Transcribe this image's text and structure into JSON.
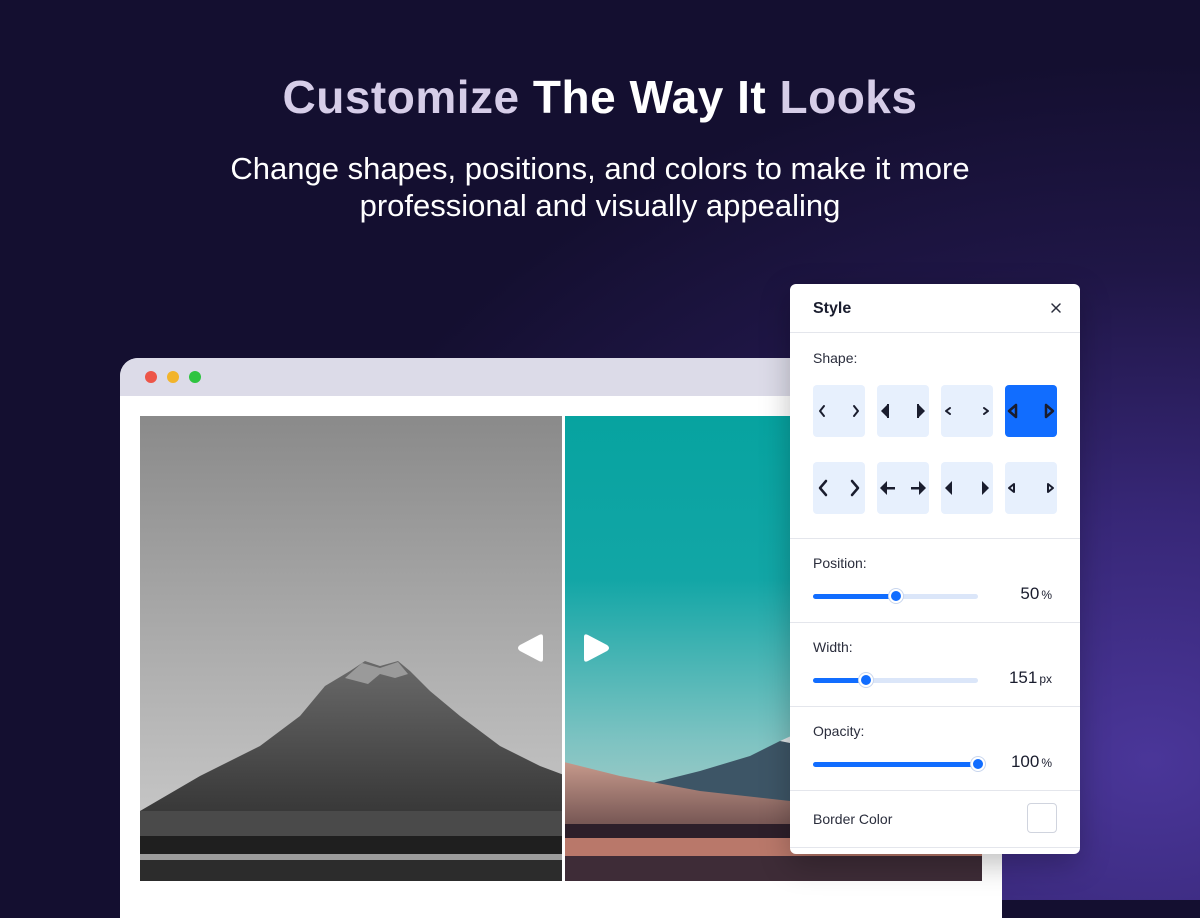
{
  "hero": {
    "title_part1": "Customize ",
    "title_part2": "The Way It",
    "title_part3": " Looks",
    "subtitle_line1": "Change shapes, positions, and colors to make it more",
    "subtitle_line2": "professional and visually appealing"
  },
  "browser": {
    "window_controls": [
      "close",
      "minimize",
      "maximize"
    ],
    "comparison": {
      "left_image": "grayscale mountain and lake",
      "right_image": "color mountain with teal sky at sunset",
      "handle_icons": [
        "triangle-left-icon",
        "triangle-right-icon"
      ]
    }
  },
  "panel": {
    "title": "Style",
    "close_icon": "close-icon",
    "shape": {
      "label": "Shape:",
      "options": [
        {
          "icon": "chevron-thin-icon",
          "selected": false
        },
        {
          "icon": "triangle-bar-icon",
          "selected": false
        },
        {
          "icon": "chevron-small-icon",
          "selected": false
        },
        {
          "icon": "triangle-outline-icon",
          "selected": true
        },
        {
          "icon": "chevron-large-icon",
          "selected": false
        },
        {
          "icon": "arrow-icon",
          "selected": false
        },
        {
          "icon": "triangle-solid-icon",
          "selected": false
        },
        {
          "icon": "triangle-tiny-icon",
          "selected": false
        }
      ]
    },
    "position": {
      "label": "Position:",
      "value": "50",
      "unit": "%",
      "fraction": 0.5
    },
    "width": {
      "label": "Width:",
      "value": "151",
      "unit": "px",
      "fraction": 0.32
    },
    "opacity": {
      "label": "Opacity:",
      "value": "100",
      "unit": "%",
      "fraction": 1.0
    },
    "border_color": {
      "label": "Border Color",
      "value": "#ffffff"
    }
  },
  "colors": {
    "accent": "#116dff",
    "background": "#1f1646"
  }
}
